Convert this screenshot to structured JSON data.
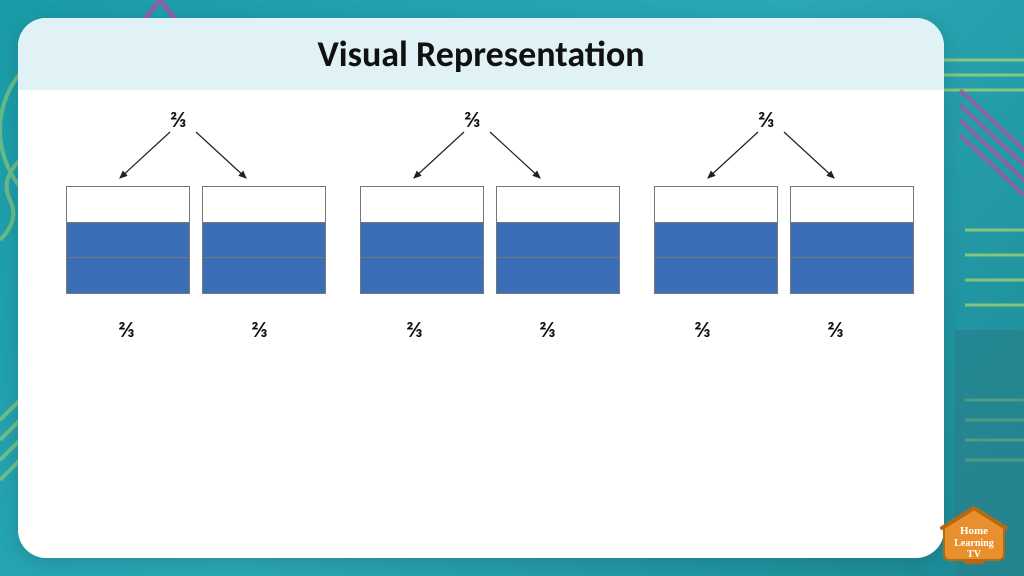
{
  "title": "Visual Representation",
  "fraction_glyph": "⅔",
  "top_labels": [
    "⅔",
    "⅔",
    "⅔"
  ],
  "bottom_labels": [
    "⅔",
    "⅔",
    "⅔",
    "⅔",
    "⅔",
    "⅔"
  ],
  "chart_data": {
    "type": "bar",
    "description": "Six identical fraction bars each divided into 3 equal horizontal thirds with the bottom 2 thirds shaded, grouped into 3 pairs each labeled 2/3.",
    "groups": 3,
    "bars_per_group": 2,
    "thirds_per_bar": 3,
    "filled_thirds_per_bar": 2,
    "group_label": "⅔",
    "bar_label": "⅔",
    "fill_color": "#3a6fb7"
  },
  "logo": {
    "line1": "Home",
    "line2": "Learning",
    "line3": "TV"
  }
}
